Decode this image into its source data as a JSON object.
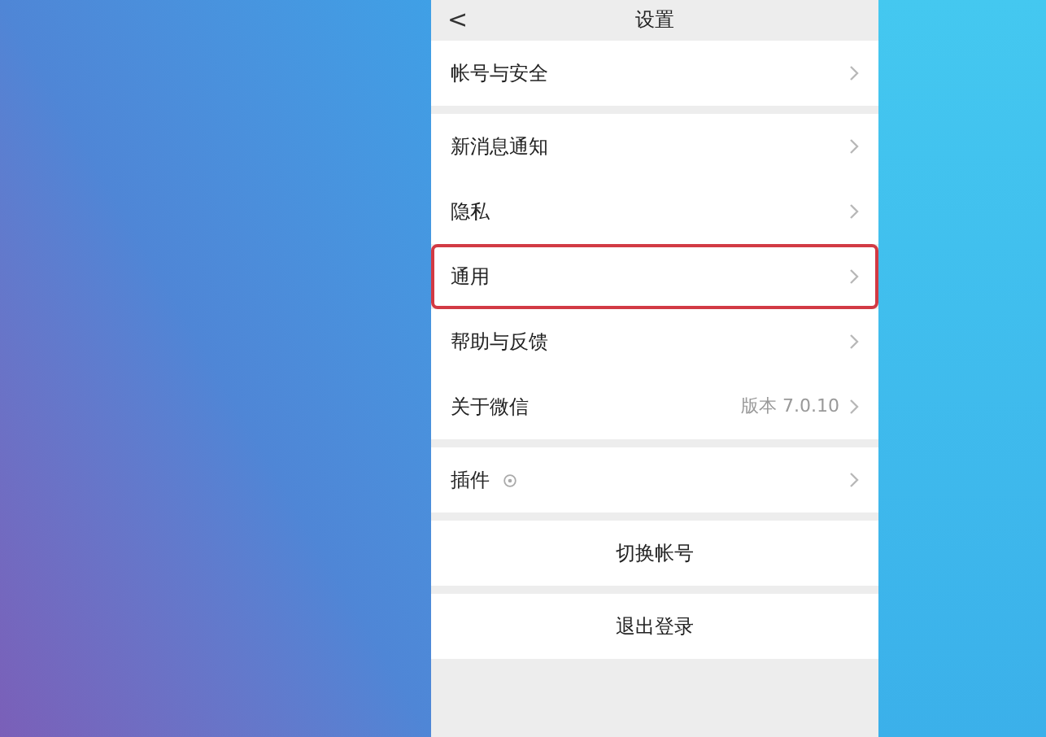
{
  "header": {
    "back": "<",
    "title": "设置"
  },
  "sections": [
    {
      "items": [
        {
          "kind": "nav",
          "label": "帐号与安全",
          "highlighted": false
        }
      ]
    },
    {
      "items": [
        {
          "kind": "nav",
          "label": "新消息通知",
          "highlighted": false
        },
        {
          "kind": "nav",
          "label": "隐私",
          "highlighted": false
        },
        {
          "kind": "nav",
          "label": "通用",
          "highlighted": true
        },
        {
          "kind": "nav",
          "label": "帮助与反馈",
          "highlighted": false
        },
        {
          "kind": "nav",
          "label": "关于微信",
          "value": "版本 7.0.10",
          "highlighted": false
        }
      ]
    },
    {
      "items": [
        {
          "kind": "plugin",
          "label": "插件",
          "highlighted": false
        }
      ]
    },
    {
      "items": [
        {
          "kind": "action",
          "label": "切换帐号",
          "highlighted": false
        }
      ]
    },
    {
      "items": [
        {
          "kind": "action",
          "label": "退出登录",
          "highlighted": false
        }
      ]
    }
  ]
}
